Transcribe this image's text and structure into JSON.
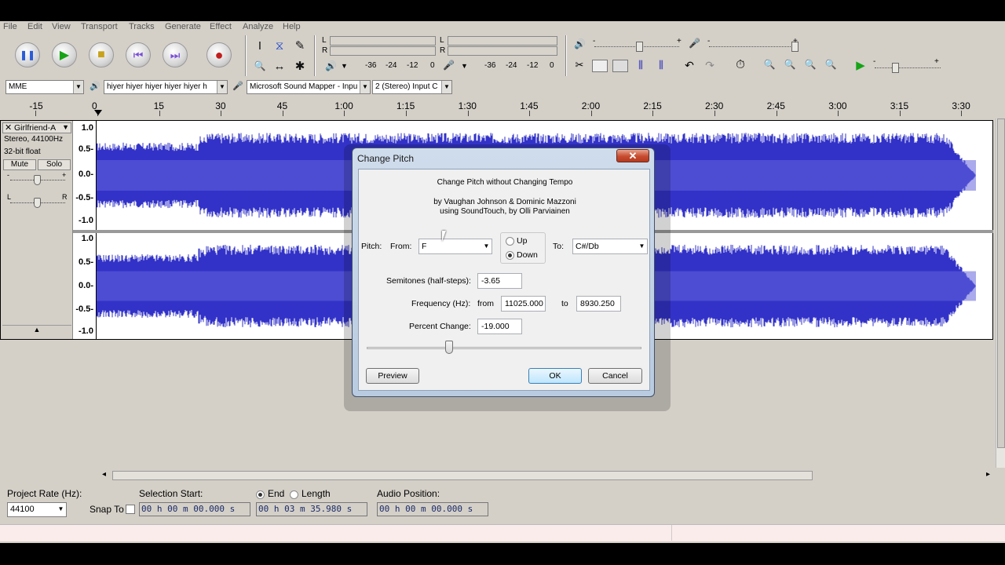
{
  "menu": [
    "File",
    "Edit",
    "View",
    "Transport",
    "Tracks",
    "Generate",
    "Effect",
    "Analyze",
    "Help"
  ],
  "meters": {
    "l": "L",
    "r": "R",
    "scale_play": [
      "-36",
      "-24",
      "-12",
      "0"
    ],
    "scale_rec": [
      "-36",
      "-24",
      "-12",
      "0"
    ],
    "minus": "-",
    "plus": "+"
  },
  "devices": {
    "host": "MME",
    "output": "hiyer hiyer hiyer hiyer hiyer h",
    "input": "Microsoft Sound Mapper - Inpu",
    "channels": "2 (Stereo) Input C"
  },
  "ruler": {
    "labels": [
      "-15",
      "0",
      "15",
      "30",
      "45",
      "1:00",
      "1:15",
      "1:30",
      "1:45",
      "2:00",
      "2:15",
      "2:30",
      "2:45",
      "3:00",
      "3:15",
      "3:30"
    ]
  },
  "track": {
    "name": "Girlfriend-A",
    "format": "Stereo, 44100Hz",
    "bits": "32-bit float",
    "mute": "Mute",
    "solo": "Solo",
    "gain_minus": "-",
    "gain_plus": "+",
    "pan_left": "L",
    "pan_right": "R",
    "scale": [
      "1.0",
      "0.5-",
      "0.0-",
      "-0.5-",
      "-1.0"
    ],
    "waveform_color": "#3232c8"
  },
  "dialog": {
    "title": "Change Pitch",
    "close": "✕",
    "heading": "Change Pitch without Changing Tempo",
    "credit1": "by Vaughan Johnson & Dominic Mazzoni",
    "credit2": "using SoundTouch, by Olli Parviainen",
    "pitch_label": "Pitch:",
    "from_label": "From:",
    "from_value": "F",
    "up_label": "Up",
    "down_label": "Down",
    "direction": "Down",
    "to_label": "To:",
    "to_value": "C#/Db",
    "semitones_label": "Semitones (half-steps):",
    "semitones_value": "-3.65",
    "frequency_label": "Frequency (Hz):",
    "freq_from_label": "from",
    "freq_from_value": "11025.000",
    "freq_to_label": "to",
    "freq_to_value": "8930.250",
    "percent_label": "Percent Change:",
    "percent_value": "-19.000",
    "slider_position": 0.3,
    "preview": "Preview",
    "ok": "OK",
    "cancel": "Cancel"
  },
  "status": {
    "project_rate_label": "Project Rate (Hz):",
    "project_rate": "44100",
    "snap_to": "Snap To",
    "selection_start_label": "Selection Start:",
    "selection_start": "00 h 00 m 00.000 s",
    "end_label": "End",
    "length_label": "Length",
    "end_value": "00 h 03 m 35.980 s",
    "audio_position_label": "Audio Position:",
    "audio_position": "00 h 00 m 00.000 s"
  },
  "icons": {
    "pause": "❚❚",
    "play": "▶",
    "stop": "■",
    "skip_start": "⏮",
    "skip_end": "⏭",
    "record": "●",
    "select": "I",
    "envelope": "⧖",
    "draw": "✎",
    "zoom": "🔍",
    "timeshift": "↔",
    "multi": "✱",
    "speaker": "🔊",
    "mic": "🎤",
    "scroll_left": "◂",
    "scroll_right": "▸",
    "collapse": "▲"
  }
}
